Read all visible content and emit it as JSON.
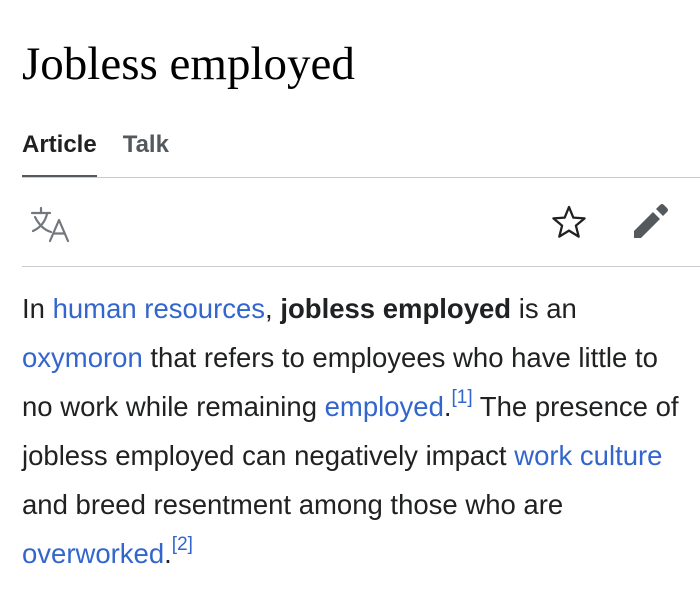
{
  "page": {
    "title": "Jobless employed"
  },
  "tabs": [
    {
      "label": "Article",
      "active": true
    },
    {
      "label": "Talk",
      "active": false
    }
  ],
  "toolbar": {
    "language_icon": "translate-icon",
    "watch_icon": "star-icon",
    "edit_icon": "pencil-icon"
  },
  "article": {
    "s1": "In ",
    "link_human_resources": "human resources",
    "s2": ", ",
    "bold_term": "jobless employed",
    "s3": " is an ",
    "link_oxymoron": "oxymoron",
    "s4": " that refers to employees who have little to no work while remaining ",
    "link_employed": "employed",
    "s5": ".",
    "ref1": "[1]",
    "s6": " The presence of jobless employed can negatively impact ",
    "link_work_culture": "work culture",
    "s7": " and breed resentment among those who are ",
    "link_overworked": "overworked",
    "s8": ".",
    "ref2": "[2]"
  },
  "colors": {
    "link": "#3366cc",
    "text": "#202122",
    "icon": "#54595d",
    "divider": "#c8ccd1"
  }
}
